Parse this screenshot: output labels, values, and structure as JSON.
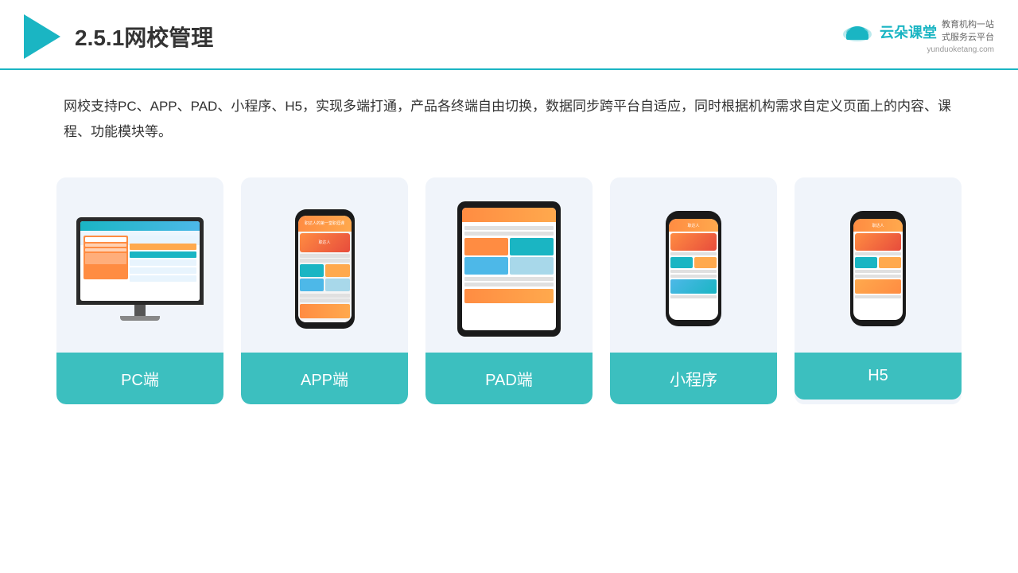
{
  "header": {
    "title": "2.5.1网校管理",
    "brand": {
      "name": "云朵课堂",
      "url": "yunduoketang.com",
      "tagline": "教育机构一站\n式服务云平台"
    }
  },
  "description": "网校支持PC、APP、PAD、小程序、H5，实现多端打通，产品各终端自由切换，数据同步跨平台自适应，同时根据机构需求自定义页面上的内容、课程、功能模块等。",
  "cards": [
    {
      "id": "pc",
      "label": "PC端"
    },
    {
      "id": "app",
      "label": "APP端"
    },
    {
      "id": "pad",
      "label": "PAD端"
    },
    {
      "id": "miniapp",
      "label": "小程序"
    },
    {
      "id": "h5",
      "label": "H5"
    }
  ],
  "colors": {
    "accent": "#1ab5c3",
    "card_bg": "#eef2f8",
    "card_label_bg": "#3cbfbf"
  }
}
